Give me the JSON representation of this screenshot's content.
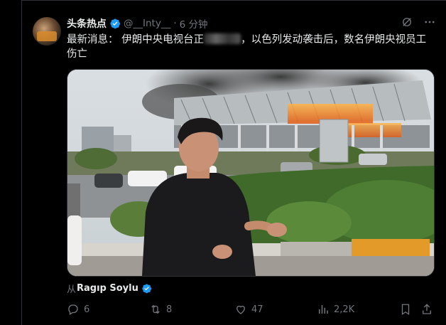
{
  "tweet": {
    "author_name": "头条热点",
    "handle": "@__Inty__",
    "separator": "·",
    "time": "6 分钟",
    "text_before_redaction": "最新消息： 伊朗中央电视台正",
    "text_after_redaction": "，以色列发动袭击后，数名伊朗央视员工伤亡"
  },
  "attribution": {
    "prefix": "从",
    "source": "Ragıp Soylu"
  },
  "actions": {
    "replies": "6",
    "retweets": "8",
    "likes": "47",
    "views": "2,2K"
  },
  "icons": [
    "verified-badge-icon",
    "grok-icon",
    "more-icon",
    "reply-icon",
    "retweet-icon",
    "like-icon",
    "views-icon",
    "bookmark-icon",
    "share-icon"
  ],
  "colors": {
    "verified": "#1d9bf0",
    "muted": "#71767b",
    "text": "#e7e9ea",
    "background": "#000000"
  }
}
